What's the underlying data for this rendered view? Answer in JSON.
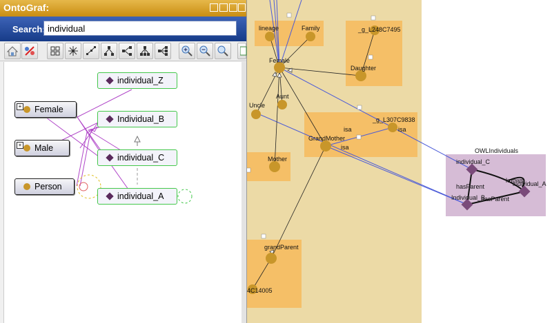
{
  "panel": {
    "title": "OntoGraf:",
    "search_label": "Search:",
    "search_value": "individual"
  },
  "toolbar": {
    "tools": [
      "home-icon",
      "remove-icon",
      "grid-layout-icon",
      "radial-layout-icon",
      "spring-layout-icon",
      "tree-layout-icon",
      "horizontal-tree-icon",
      "vertical-tree-icon",
      "horizontal-tree-2-icon",
      "zoom-in-icon",
      "zoom-out-icon",
      "zoom-fit-icon",
      "export-icon"
    ]
  },
  "left_graph": {
    "classes": [
      "Female",
      "Male",
      "Person"
    ],
    "individuals": [
      "individual_Z",
      "Individual_B",
      "individual_C",
      "individual_A"
    ]
  },
  "right_graph": {
    "nodes": {
      "lineage": "lineage",
      "family": "Family",
      "g248": "_g_L248C7495",
      "female": "Female",
      "daughter": "Daughter",
      "aunt": "Aunt",
      "uncle": "Uncle",
      "g307": "_g_L307C9838",
      "grandmother": "GrandMother",
      "mother": "Mother",
      "grandparent": "grandParent",
      "c14005": "4C14005",
      "owl_group": "OWLIndividuals",
      "ind_c": "individual_C",
      "ind_b": "Individual_B",
      "ind_a": "individual_A"
    },
    "edge_labels": {
      "isa1": "isa",
      "isa2": "isa",
      "isa3": "isa",
      "hasparent1": "hasParent",
      "hasparent2": "hasParent",
      "knows": "knows"
    }
  },
  "colors": {
    "title_bar": "#d9a132",
    "search_bar": "#284c9f",
    "class_dot": "#c8962a",
    "individual_diamond": "#5a2a5c",
    "individual_border": "#43c74a",
    "cluster_fill": "#f5bf67",
    "background_cluster": "#ecdaa6",
    "owl_cluster": "#d6bcd6"
  }
}
